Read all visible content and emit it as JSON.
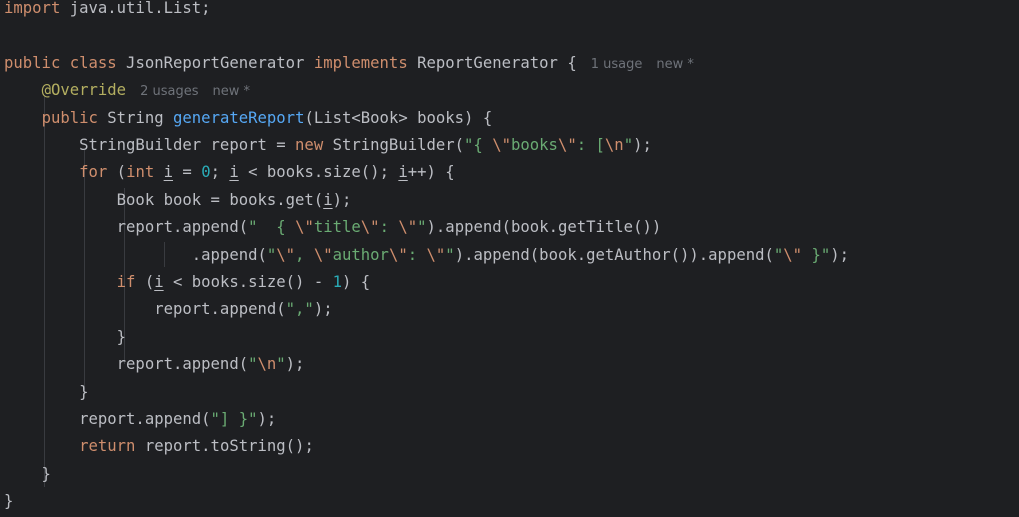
{
  "editor": {
    "lines": [
      [
        {
          "t": "import",
          "c": "kw"
        },
        {
          "t": " java.util.List;"
        }
      ],
      [],
      [
        {
          "t": "public class",
          "c": "kw"
        },
        {
          "t": " JsonReportGenerator "
        },
        {
          "t": "implements",
          "c": "kw"
        },
        {
          "t": " ReportGenerator {"
        },
        {
          "gap": true
        },
        {
          "t": "1 usage",
          "c": "hint"
        },
        {
          "gap": true
        },
        {
          "t": "new *",
          "c": "hint"
        }
      ],
      [
        {
          "t": "    "
        },
        {
          "t": "@Override",
          "c": "ann"
        },
        {
          "gap": true
        },
        {
          "t": "2 usages",
          "c": "hint"
        },
        {
          "gap": true
        },
        {
          "t": "new *",
          "c": "hint"
        }
      ],
      [
        {
          "t": "    "
        },
        {
          "t": "public",
          "c": "kw"
        },
        {
          "t": " String "
        },
        {
          "t": "generateReport",
          "c": "fn"
        },
        {
          "t": "(List<Book> books) {"
        }
      ],
      [
        {
          "t": "        StringBuilder report = "
        },
        {
          "t": "new",
          "c": "kw"
        },
        {
          "t": " StringBuilder("
        },
        {
          "t": "\"{ ",
          "c": "str"
        },
        {
          "t": "\\\"",
          "c": "esc"
        },
        {
          "t": "books",
          "c": "str"
        },
        {
          "t": "\\\"",
          "c": "esc"
        },
        {
          "t": ": [",
          "c": "str"
        },
        {
          "t": "\\n",
          "c": "esc"
        },
        {
          "t": "\"",
          "c": "str"
        },
        {
          "t": ");"
        }
      ],
      [
        {
          "t": "        "
        },
        {
          "t": "for",
          "c": "kw"
        },
        {
          "t": " ("
        },
        {
          "t": "int",
          "c": "kw"
        },
        {
          "t": " "
        },
        {
          "t": "i",
          "c": "uvar"
        },
        {
          "t": " = "
        },
        {
          "t": "0",
          "c": "num"
        },
        {
          "t": "; "
        },
        {
          "t": "i",
          "c": "uvar"
        },
        {
          "t": " < books.size(); "
        },
        {
          "t": "i",
          "c": "uvar"
        },
        {
          "t": "++) {"
        }
      ],
      [
        {
          "t": "            Book book = books.get("
        },
        {
          "t": "i",
          "c": "uvar"
        },
        {
          "t": ");"
        }
      ],
      [
        {
          "t": "            report.append("
        },
        {
          "t": "\"  { ",
          "c": "str"
        },
        {
          "t": "\\\"",
          "c": "esc"
        },
        {
          "t": "title",
          "c": "str"
        },
        {
          "t": "\\\"",
          "c": "esc"
        },
        {
          "t": ": ",
          "c": "str"
        },
        {
          "t": "\\\"",
          "c": "esc"
        },
        {
          "t": "\"",
          "c": "str"
        },
        {
          "t": ").append(book.getTitle())"
        }
      ],
      [
        {
          "t": "                    .append("
        },
        {
          "t": "\"",
          "c": "str"
        },
        {
          "t": "\\\"",
          "c": "esc"
        },
        {
          "t": ", ",
          "c": "str"
        },
        {
          "t": "\\\"",
          "c": "esc"
        },
        {
          "t": "author",
          "c": "str"
        },
        {
          "t": "\\\"",
          "c": "esc"
        },
        {
          "t": ": ",
          "c": "str"
        },
        {
          "t": "\\\"",
          "c": "esc"
        },
        {
          "t": "\"",
          "c": "str"
        },
        {
          "t": ").append(book.getAuthor()).append("
        },
        {
          "t": "\"",
          "c": "str"
        },
        {
          "t": "\\\"",
          "c": "esc"
        },
        {
          "t": " }\"",
          "c": "str"
        },
        {
          "t": ");"
        }
      ],
      [
        {
          "t": "            "
        },
        {
          "t": "if",
          "c": "kw"
        },
        {
          "t": " ("
        },
        {
          "t": "i",
          "c": "uvar"
        },
        {
          "t": " < books.size() - "
        },
        {
          "t": "1",
          "c": "num"
        },
        {
          "t": ") {"
        }
      ],
      [
        {
          "t": "                report.append("
        },
        {
          "t": "\",\"",
          "c": "str"
        },
        {
          "t": ");"
        }
      ],
      [
        {
          "t": "            }"
        }
      ],
      [
        {
          "t": "            report.append("
        },
        {
          "t": "\"",
          "c": "str"
        },
        {
          "t": "\\n",
          "c": "esc"
        },
        {
          "t": "\"",
          "c": "str"
        },
        {
          "t": ");"
        }
      ],
      [
        {
          "t": "        }"
        }
      ],
      [
        {
          "t": "        report.append("
        },
        {
          "t": "\"] }\"",
          "c": "str"
        },
        {
          "t": ");"
        }
      ],
      [
        {
          "t": "        "
        },
        {
          "t": "return",
          "c": "kw"
        },
        {
          "t": " report.toString();"
        }
      ],
      [
        {
          "t": "    }"
        }
      ],
      [
        {
          "t": "}"
        }
      ]
    ]
  }
}
